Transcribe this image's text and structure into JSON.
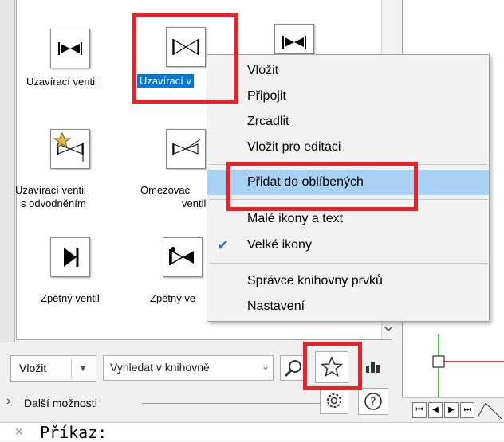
{
  "library": {
    "items": [
      {
        "label": "Uzavírací ventil",
        "icon": "valve-solid-icon"
      },
      {
        "label": "Uzavírací v",
        "icon": "valve-outline-icon",
        "selected": true
      },
      {
        "label": "",
        "icon": "valve-solid-icon"
      },
      {
        "label_line1": "Uzavírací ventil",
        "label_line2": "s odvodněním",
        "icon": "valve-drain-favorite-icon"
      },
      {
        "label_line1": "Omezovac",
        "label_line2": "ventil",
        "icon": "limiting-valve-icon"
      },
      {
        "label": "Zpětný ventil",
        "icon": "check-valve-icon"
      },
      {
        "label": "Zpětný ve",
        "icon": "check-valve-2-icon"
      }
    ]
  },
  "context_menu": {
    "items": [
      {
        "label": "Vložit"
      },
      {
        "label": "Připojit"
      },
      {
        "label": "Zrcadlit"
      },
      {
        "label": "Vložit pro editaci"
      },
      {
        "label": "Přidat do oblíbených",
        "highlighted": true
      },
      {
        "label": "Malé ikony a text"
      },
      {
        "label": "Velké ikony",
        "checked": true
      },
      {
        "label": "Správce knihovny prvků"
      },
      {
        "label": "Nastavení"
      }
    ]
  },
  "toolbar": {
    "insert_label": "Vložit",
    "search_placeholder": "Vyhledat v knihovně",
    "more_label": "Další možnosti"
  },
  "command": {
    "prompt": "Příkaz:"
  },
  "colors": {
    "selection": "#0078d7",
    "menu_highlight": "#a9d1f3",
    "annotation_red": "#e4242b"
  }
}
